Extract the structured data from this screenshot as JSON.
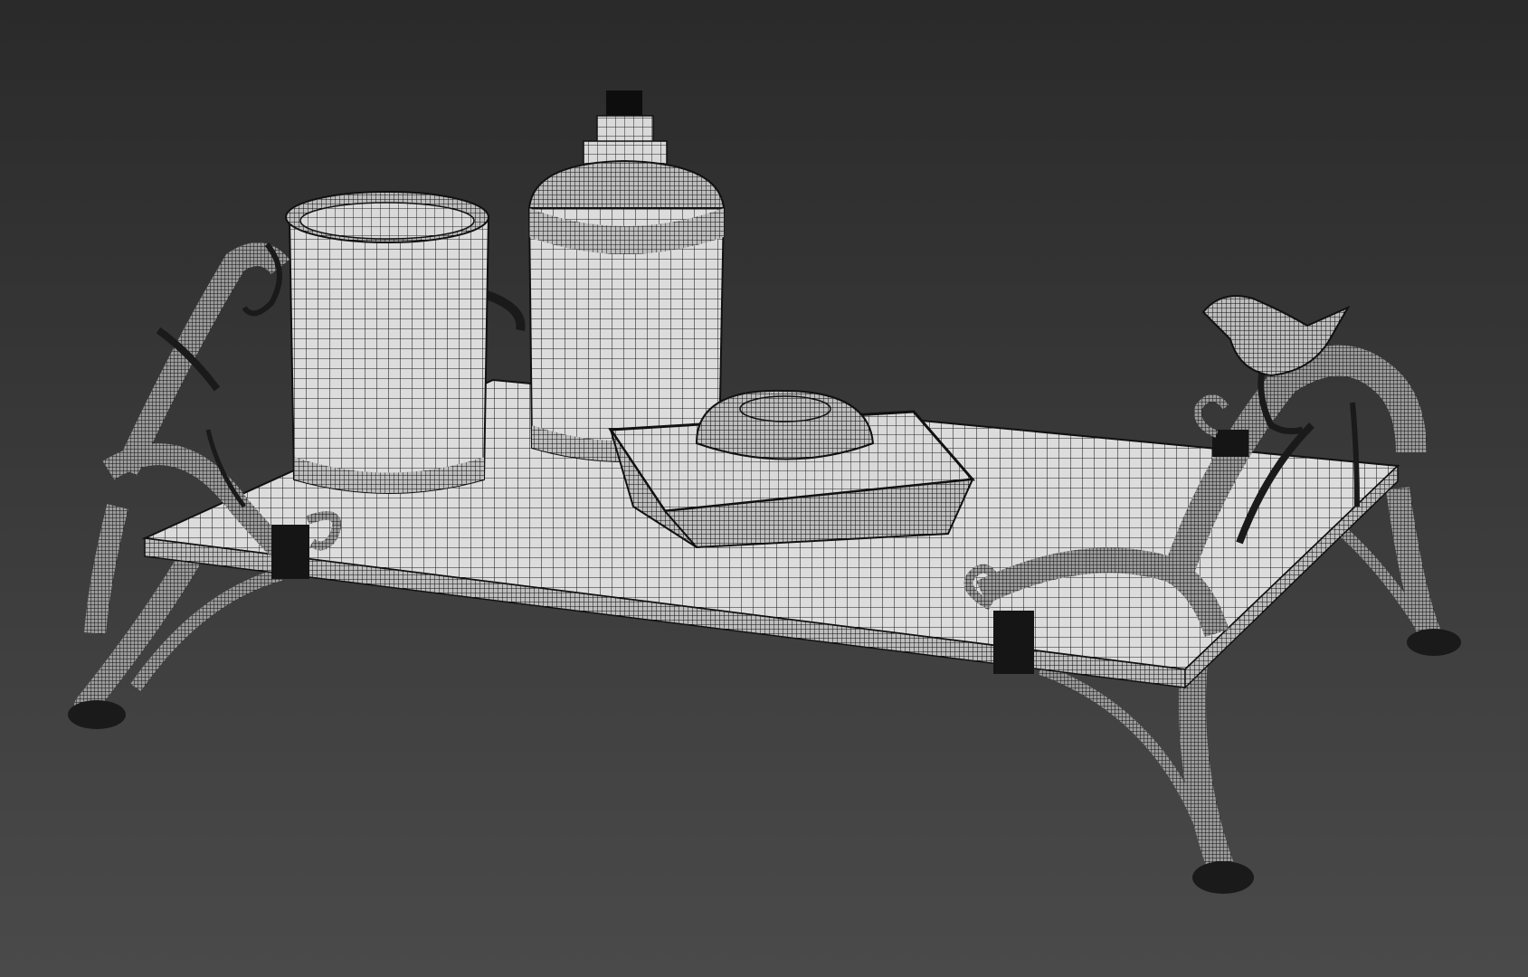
{
  "viewport": {
    "background_top": "#2a2a2a",
    "background_bottom": "#4a4a4a"
  },
  "scene": {
    "render_style": "wireframe-on-shaded",
    "objects": [
      {
        "name": "tray"
      },
      {
        "name": "cup"
      },
      {
        "name": "soap-dispenser"
      },
      {
        "name": "soap-dish"
      },
      {
        "name": "soap-bar"
      },
      {
        "name": "bird-ornament"
      },
      {
        "name": "left-handle"
      },
      {
        "name": "right-handle"
      },
      {
        "name": "legs"
      }
    ],
    "colors": {
      "surface": "#d9d9d9",
      "wire": "#111111",
      "dark_metal": "#1a1a1a"
    }
  }
}
